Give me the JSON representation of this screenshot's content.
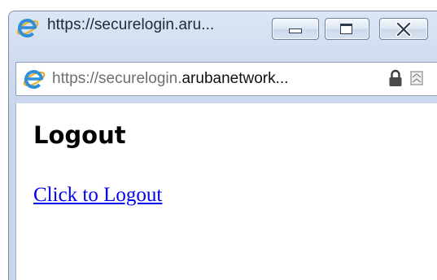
{
  "window": {
    "title": "https://securelogin.aru...",
    "minimize_icon": "minimize-icon",
    "maximize_icon": "maximize-icon",
    "close_icon": "close-icon",
    "browser_icon": "internet-explorer-icon"
  },
  "address_bar": {
    "url_prefix": "https://securelogin.",
    "url_domain": "arubanetwork...",
    "lock_icon": "lock-icon",
    "compat_icon": "compatibility-view-icon"
  },
  "page": {
    "heading": "Logout",
    "link_text": "Click to Logout"
  },
  "colors": {
    "link": "#0000ee",
    "frame": "#cfdcee",
    "ie_logo": "#2f8fd8"
  }
}
